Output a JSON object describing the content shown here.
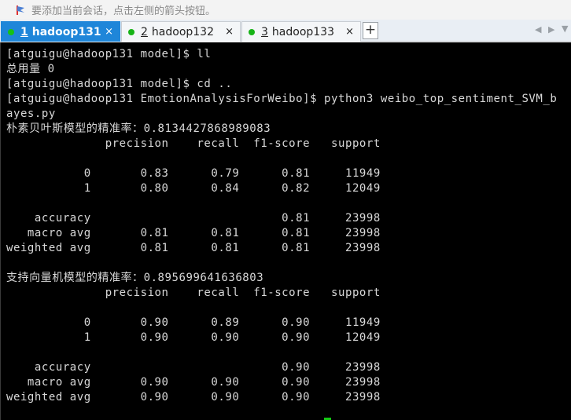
{
  "hint_bar": {
    "text": "要添加当前会话，点击左侧的箭头按钮。",
    "icon": "pin-arrow-icon"
  },
  "tabs": [
    {
      "number": "1",
      "label": "hadoop131",
      "active": true,
      "status_color": "#16c216"
    },
    {
      "number": "2",
      "label": "hadoop132",
      "active": false,
      "status_color": "#16b316"
    },
    {
      "number": "3",
      "label": "hadoop133",
      "active": false,
      "status_color": "#16b316"
    }
  ],
  "tab_bar": {
    "close_symbol": "×",
    "add_symbol": "+",
    "prev_symbol": "◀",
    "next_symbol": "▶",
    "menu_symbol": "▼"
  },
  "terminal": {
    "background": "#000000",
    "text_color": "#d8d8d8",
    "cursor_color": "#14c814",
    "lines": [
      "[atguigu@hadoop131 model]$ ll",
      "总用量 0",
      "[atguigu@hadoop131 model]$ cd ..",
      "[atguigu@hadoop131 EmotionAnalysisForWeibo]$ python3 weibo_top_sentiment_SVM_b",
      "ayes.py",
      "朴素贝叶斯模型的精准率：0.8134427868989083",
      "              precision    recall  f1-score   support",
      "",
      "           0       0.83      0.79      0.81     11949",
      "           1       0.80      0.84      0.82     12049",
      "",
      "    accuracy                           0.81     23998",
      "   macro avg       0.81      0.81      0.81     23998",
      "weighted avg       0.81      0.81      0.81     23998",
      "",
      "支持向量机模型的精准率：0.895699641636803",
      "              precision    recall  f1-score   support",
      "",
      "           0       0.90      0.89      0.90     11949",
      "           1       0.90      0.90      0.90     12049",
      "",
      "    accuracy                           0.90     23998",
      "   macro avg       0.90      0.90      0.90     23998",
      "weighted avg       0.90      0.90      0.90     23998"
    ]
  }
}
